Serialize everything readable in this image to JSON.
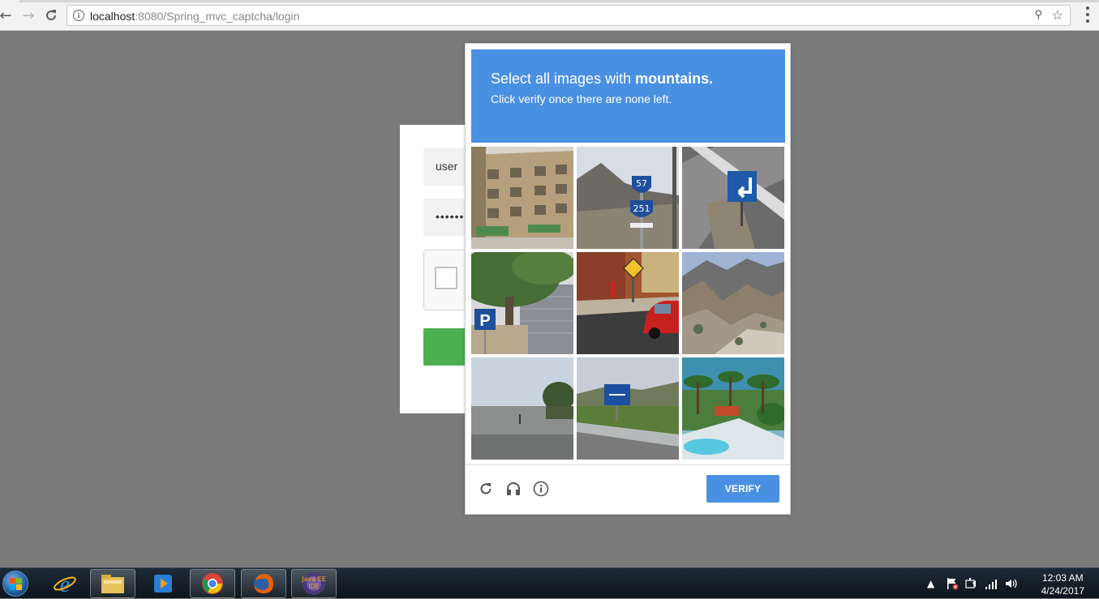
{
  "browser": {
    "url_host": "localhost",
    "url_rest": ":8080/Spring_mvc_captcha/login",
    "icons": [
      "back-icon",
      "forward-icon",
      "reload-icon",
      "info-icon",
      "key-icon",
      "star-icon",
      "menu-icon"
    ]
  },
  "login": {
    "username_value": "user",
    "password_value": "••••••••••",
    "submit_color": "#4caf50"
  },
  "challenge": {
    "title_prefix": "Select all images with ",
    "title_keyword": "mountains.",
    "subtitle": "Click verify once there are none left.",
    "header_color": "#4a90e2",
    "tiles": [
      {
        "name": "building"
      },
      {
        "name": "route-signs"
      },
      {
        "name": "arrow-sign"
      },
      {
        "name": "parking-tree"
      },
      {
        "name": "pedestrian-street"
      },
      {
        "name": "mountains"
      },
      {
        "name": "sea-shore"
      },
      {
        "name": "highway-sign"
      },
      {
        "name": "palm-resort"
      }
    ],
    "verify_label": "VERIFY",
    "footer_icons": [
      "reload-icon",
      "headphones-icon",
      "info-icon"
    ]
  },
  "taskbar": {
    "apps": [
      "internet-explorer",
      "file-explorer",
      "media-player",
      "chrome",
      "firefox",
      "java-ee-ide"
    ],
    "java_label": "Java EE IDE",
    "time": "12:03 AM",
    "date": "4/24/2017"
  }
}
